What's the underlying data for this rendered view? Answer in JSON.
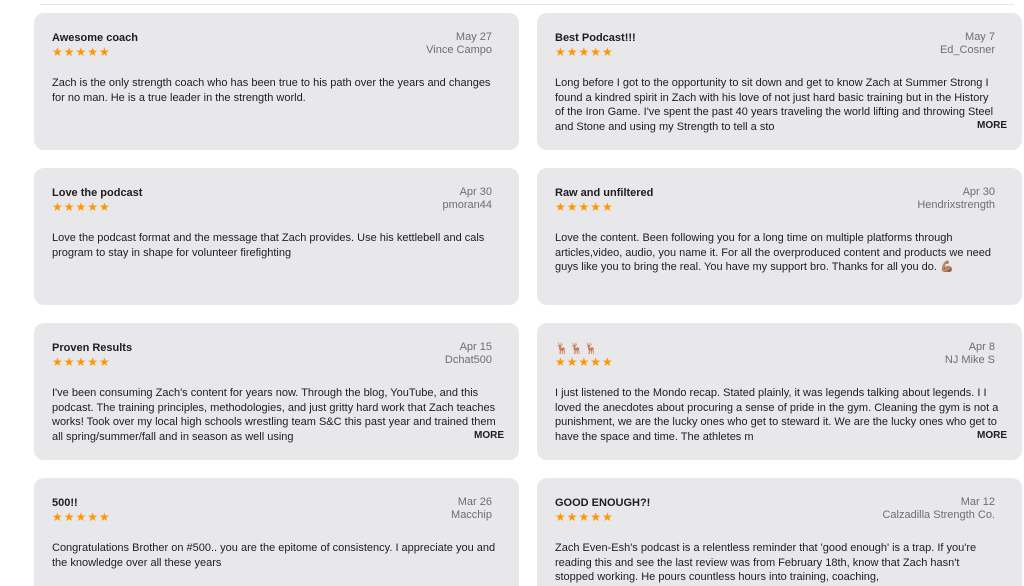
{
  "colors": {
    "star": "#ff9500",
    "card_bg": "#e8e8ea",
    "muted": "#6e6e73"
  },
  "reviews": [
    {
      "title": "Awesome coach",
      "stars": "★★★★★",
      "rating": 5,
      "date": "May 27",
      "author": "Vince Campo",
      "body": "Zach is the only strength coach who has been true to his path over the years and changes for no man. He is a true leader in the strength world.",
      "more": ""
    },
    {
      "title": "Best Podcast!!!",
      "stars": "★★★★★",
      "rating": 5,
      "date": "May 7",
      "author": "Ed_Cosner",
      "body": "Long before I got to the opportunity to sit down and get to know Zach at Summer Strong I found a kindred spirit in Zach with his love of not just hard basic training but in the History of the Iron Game. I've spent the past 40 years traveling the world lifting and throwing Steel and Stone and using my Strength to tell a sto",
      "more": "MORE"
    },
    {
      "title": "Love the podcast",
      "stars": "★★★★★",
      "rating": 5,
      "date": "Apr 30",
      "author": "pmoran44",
      "body": "Love the podcast format and the message that Zach provides. Use his kettlebell and cals program to stay in shape for volunteer firefighting",
      "more": ""
    },
    {
      "title": "Raw and unfiltered",
      "stars": "★★★★★",
      "rating": 5,
      "date": "Apr 30",
      "author": "Hendrixstrength",
      "body": "Love the content. Been following you for a long time on multiple platforms through articles,video, audio, you name it. For all the overproduced content and products we need guys like you to bring the real. You have my support bro. Thanks for all you do. 💪🏽",
      "more": ""
    },
    {
      "title": "Proven Results",
      "stars": "★★★★★",
      "rating": 5,
      "date": "Apr 15",
      "author": "Dchat500",
      "body": "I've been consuming Zach's content for years now. Through the blog, YouTube, and this podcast. The training principles, methodologies, and just gritty hard work that Zach teaches works! Took over my local high schools wrestling team S&C this past year and trained them all spring/summer/fall and in season as well using",
      "more": "MORE"
    },
    {
      "title": "🦌🦌🦌",
      "stars": "★★★★★",
      "rating": 5,
      "date": "Apr 8",
      "author": "NJ Mike S",
      "body": "I just listened to the Mondo recap. Stated plainly, it was legends talking  about legends. I I loved the anecdotes about procuring a sense of pride in the gym. Cleaning the gym is not a punishment, we are the lucky ones who get to steward it. We are the lucky ones who get to have the space and time. The athletes m",
      "more": "MORE"
    },
    {
      "title": "500!!",
      "stars": "★★★★★",
      "rating": 5,
      "date": "Mar 26",
      "author": "Macchip",
      "body": "Congratulations Brother on #500.. you are the epitome of consistency. I appreciate you and  the knowledge over all these years",
      "more": ""
    },
    {
      "title": "GOOD ENOUGH?!",
      "stars": "★★★★★",
      "rating": 5,
      "date": "Mar 12",
      "author": "Calzadilla Strength Co.",
      "body": "Zach Even-Esh's podcast is a relentless reminder that 'good enough' is a trap. If you're reading this and see the last review was from February 18th, know that Zach hasn't stopped working. He pours countless hours into training, coaching,",
      "more": ""
    }
  ]
}
